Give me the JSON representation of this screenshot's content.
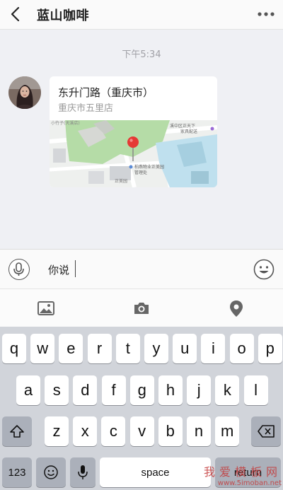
{
  "header": {
    "title": "蓝山咖啡"
  },
  "chat": {
    "timestamp": "下午5:34",
    "message": {
      "location_name": "东升门路（重庆市）",
      "location_address": "重庆市五里店",
      "map_labels": {
        "top_left": "小竹子(天溪店)",
        "right_top": "溪中区正天下",
        "right_sub": "家具配送",
        "poi": "柏燕物业正美园",
        "poi_sub": "管理处",
        "bottom": "正美园"
      }
    }
  },
  "input": {
    "text": "你说"
  },
  "keyboard": {
    "row1": [
      "q",
      "w",
      "e",
      "r",
      "t",
      "y",
      "u",
      "i",
      "o",
      "p"
    ],
    "row2": [
      "a",
      "s",
      "d",
      "f",
      "g",
      "h",
      "j",
      "k",
      "l"
    ],
    "row3": [
      "z",
      "x",
      "c",
      "v",
      "b",
      "n",
      "m"
    ],
    "numbers_label": "123",
    "space_label": "space",
    "return_label": "return"
  },
  "watermark": {
    "main": "我爱模板网",
    "sub": "www.5imoban.net"
  },
  "colors": {
    "pin": "#e53935",
    "map_green": "#b5dca7",
    "map_blue": "#bfe0ee"
  }
}
